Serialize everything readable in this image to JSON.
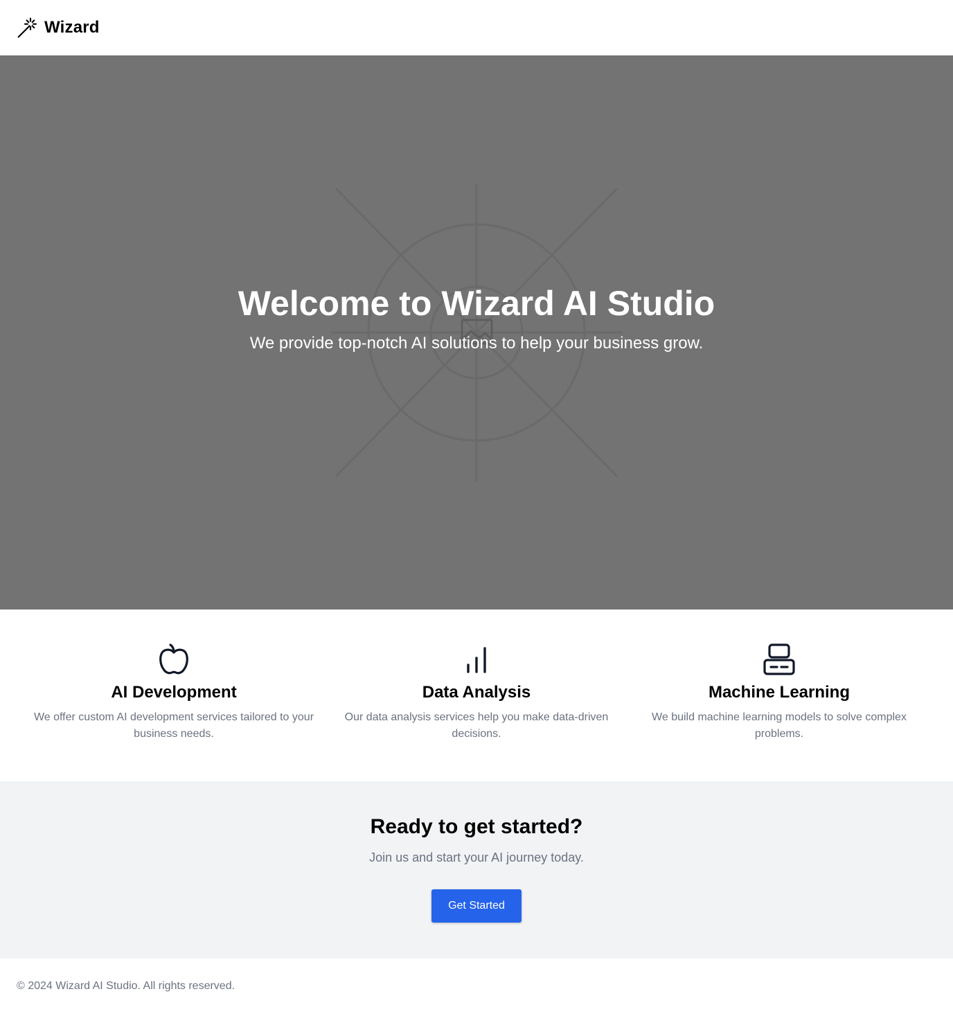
{
  "header": {
    "brand_name": "Wizard",
    "brand_icon": "magic-wand-icon"
  },
  "hero": {
    "title": "Welcome to Wizard AI Studio",
    "subtitle": "We provide top-notch AI solutions to help your business grow.",
    "background_icon": "image-placeholder-icon",
    "background_color": "#737373"
  },
  "features": [
    {
      "icon": "apple-icon",
      "title": "AI Development",
      "description": "We offer custom AI development services tailored to your business needs."
    },
    {
      "icon": "bar-chart-icon",
      "title": "Data Analysis",
      "description": "Our data analysis services help you make data-driven decisions."
    },
    {
      "icon": "server-icon",
      "title": "Machine Learning",
      "description": "We build machine learning models to solve complex problems."
    }
  ],
  "cta": {
    "title": "Ready to get started?",
    "text": "Join us and start your AI journey today.",
    "button_label": "Get Started",
    "button_color": "#2563eb"
  },
  "footer": {
    "copyright": "© 2024 Wizard AI Studio. All rights reserved."
  }
}
